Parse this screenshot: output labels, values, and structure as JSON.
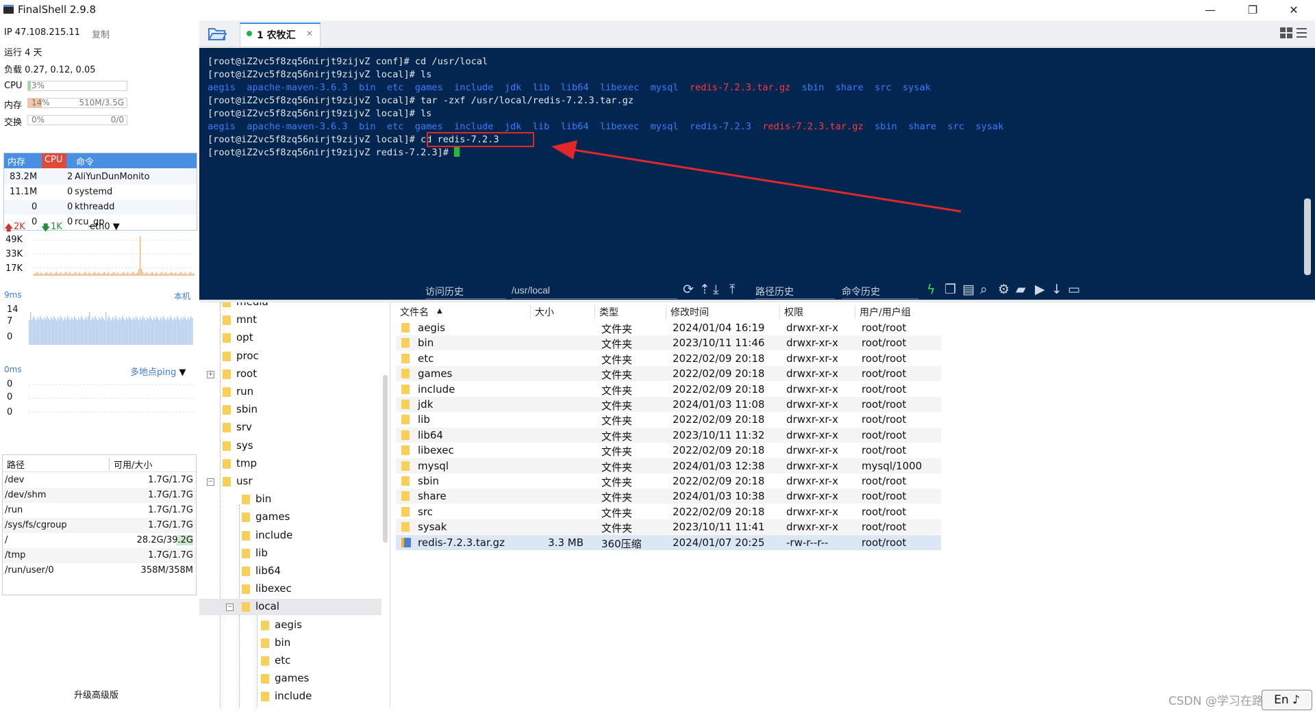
{
  "window": {
    "title": "FinalShell 2.9.8",
    "controls": {
      "minimize": "—",
      "maximize": "❐",
      "close": "✕"
    }
  },
  "sysinfo": {
    "ip_label": "IP 47.108.215.11",
    "copy_label": "复制",
    "uptime": "运行 4 天",
    "load": "负载 0.27, 0.12, 0.05",
    "cpu": {
      "label": "CPU",
      "value": "3%",
      "percent": 3
    },
    "mem": {
      "label": "内存",
      "value": "14%",
      "detail": "510M/3.5G",
      "percent": 14
    },
    "swap": {
      "label": "交换",
      "value": "0%",
      "detail": "0/0",
      "percent": 0
    }
  },
  "process_table": {
    "headers": [
      "内存",
      "CPU",
      "命令"
    ],
    "rows": [
      {
        "mem": "83.2M",
        "cpu": "2",
        "cmd": "AliYunDunMonito"
      },
      {
        "mem": "11.1M",
        "cpu": "0",
        "cmd": "systemd"
      },
      {
        "mem": "0",
        "cpu": "0",
        "cmd": "kthreadd"
      },
      {
        "mem": "0",
        "cpu": "0",
        "cmd": "rcu_gp"
      }
    ]
  },
  "network": {
    "up": "2K",
    "down": "1K",
    "interface": "eth0",
    "y_ticks": [
      "49K",
      "33K",
      "17K"
    ]
  },
  "latency": {
    "value": "9ms",
    "target": "本机",
    "y_ticks": [
      "14",
      "7",
      "0"
    ]
  },
  "ping": {
    "value": "0ms",
    "target": "多地点ping",
    "y_ticks": [
      "0",
      "0",
      "0"
    ]
  },
  "disk_table": {
    "headers": [
      "路径",
      "可用/大小"
    ],
    "rows": [
      {
        "path": "/dev",
        "size": "1.7G/1.7G"
      },
      {
        "path": "/dev/shm",
        "size": "1.7G/1.7G"
      },
      {
        "path": "/run",
        "size": "1.7G/1.7G"
      },
      {
        "path": "/sys/fs/cgroup",
        "size": "1.7G/1.7G"
      },
      {
        "path": "/",
        "size": "28.2G/39.2G"
      },
      {
        "path": "/tmp",
        "size": "1.7G/1.7G"
      },
      {
        "path": "/run/user/0",
        "size": "358M/358M"
      }
    ]
  },
  "upgrade_label": "升级高级版",
  "tab": {
    "label": "1 农牧汇",
    "close": "✕"
  },
  "terminal": {
    "lines": [
      {
        "prompt": "[root@iZ2vc5f8zq56nirjt9zijvZ conf]# ",
        "cmd": "cd /usr/local"
      },
      {
        "prompt": "[root@iZ2vc5f8zq56nirjt9zijvZ local]# ",
        "cmd": "ls"
      },
      {
        "prompt": "[root@iZ2vc5f8zq56nirjt9zijvZ local]# ",
        "cmd": "tar -zxf /usr/local/redis-7.2.3.tar.gz"
      },
      {
        "prompt": "[root@iZ2vc5f8zq56nirjt9zijvZ local]# ",
        "cmd": "ls"
      },
      {
        "prompt": "[root@iZ2vc5f8zq56nirjt9zijvZ local]# ",
        "cmd": "cd redis-7.2.3"
      },
      {
        "prompt": "[root@iZ2vc5f8zq56nirjt9zijvZ redis-7.2.3]# ",
        "cmd": ""
      }
    ],
    "ls1": [
      "aegis",
      "apache-maven-3.6.3",
      "bin",
      "etc",
      "games",
      "include",
      "jdk",
      "lib",
      "lib64",
      "libexec",
      "mysql",
      "redis-7.2.3.tar.gz",
      "sbin",
      "share",
      "src",
      "sysak"
    ],
    "ls2": [
      "aegis",
      "apache-maven-3.6.3",
      "bin",
      "etc",
      "games",
      "include",
      "jdk",
      "lib",
      "lib64",
      "libexec",
      "mysql",
      "redis-7.2.3",
      "redis-7.2.3.tar.gz",
      "sbin",
      "share",
      "src",
      "sysak"
    ],
    "archive_name": "redis-7.2.3.tar.gz",
    "colors": {
      "background": "#032650",
      "dir": "#3a7cff",
      "archive": "#ff3b3b",
      "cursor": "#19c13b",
      "highlight": "#e02828"
    }
  },
  "term_toolbar": {
    "history_label": "访问历史",
    "path_value": "/usr/local",
    "path_history_label": "路径历史",
    "cmd_history_label": "命令历史"
  },
  "tree": {
    "items": [
      {
        "label": "media",
        "depth": 0
      },
      {
        "label": "mnt",
        "depth": 0
      },
      {
        "label": "opt",
        "depth": 0
      },
      {
        "label": "proc",
        "depth": 0
      },
      {
        "label": "root",
        "depth": 0,
        "expander": "⊞"
      },
      {
        "label": "run",
        "depth": 0
      },
      {
        "label": "sbin",
        "depth": 0
      },
      {
        "label": "srv",
        "depth": 0
      },
      {
        "label": "sys",
        "depth": 0
      },
      {
        "label": "tmp",
        "depth": 0
      },
      {
        "label": "usr",
        "depth": 0,
        "expander": "⊟"
      },
      {
        "label": "bin",
        "depth": 1
      },
      {
        "label": "games",
        "depth": 1
      },
      {
        "label": "include",
        "depth": 1
      },
      {
        "label": "lib",
        "depth": 1
      },
      {
        "label": "lib64",
        "depth": 1
      },
      {
        "label": "libexec",
        "depth": 1
      },
      {
        "label": "local",
        "depth": 1,
        "expander": "⊟",
        "selected": true
      },
      {
        "label": "aegis",
        "depth": 2
      },
      {
        "label": "bin",
        "depth": 2
      },
      {
        "label": "etc",
        "depth": 2
      },
      {
        "label": "games",
        "depth": 2
      },
      {
        "label": "include",
        "depth": 2
      }
    ]
  },
  "files": {
    "headers": [
      "文件名",
      "大小",
      "类型",
      "修改时间",
      "权限",
      "用户/用户组"
    ],
    "rows": [
      {
        "name": "aegis",
        "size": "",
        "type": "文件夹",
        "mtime": "2024/01/04 16:19",
        "perm": "drwxr-xr-x",
        "owner": "root/root"
      },
      {
        "name": "bin",
        "size": "",
        "type": "文件夹",
        "mtime": "2023/10/11 11:46",
        "perm": "drwxr-xr-x",
        "owner": "root/root"
      },
      {
        "name": "etc",
        "size": "",
        "type": "文件夹",
        "mtime": "2022/02/09 20:18",
        "perm": "drwxr-xr-x",
        "owner": "root/root"
      },
      {
        "name": "games",
        "size": "",
        "type": "文件夹",
        "mtime": "2022/02/09 20:18",
        "perm": "drwxr-xr-x",
        "owner": "root/root"
      },
      {
        "name": "include",
        "size": "",
        "type": "文件夹",
        "mtime": "2022/02/09 20:18",
        "perm": "drwxr-xr-x",
        "owner": "root/root"
      },
      {
        "name": "jdk",
        "size": "",
        "type": "文件夹",
        "mtime": "2024/01/03 11:08",
        "perm": "drwxr-xr-x",
        "owner": "root/root"
      },
      {
        "name": "lib",
        "size": "",
        "type": "文件夹",
        "mtime": "2022/02/09 20:18",
        "perm": "drwxr-xr-x",
        "owner": "root/root"
      },
      {
        "name": "lib64",
        "size": "",
        "type": "文件夹",
        "mtime": "2023/10/11 11:32",
        "perm": "drwxr-xr-x",
        "owner": "root/root"
      },
      {
        "name": "libexec",
        "size": "",
        "type": "文件夹",
        "mtime": "2022/02/09 20:18",
        "perm": "drwxr-xr-x",
        "owner": "root/root"
      },
      {
        "name": "mysql",
        "size": "",
        "type": "文件夹",
        "mtime": "2024/01/03 12:38",
        "perm": "drwxr-xr-x",
        "owner": "mysql/1000"
      },
      {
        "name": "sbin",
        "size": "",
        "type": "文件夹",
        "mtime": "2022/02/09 20:18",
        "perm": "drwxr-xr-x",
        "owner": "root/root"
      },
      {
        "name": "share",
        "size": "",
        "type": "文件夹",
        "mtime": "2024/01/03 10:38",
        "perm": "drwxr-xr-x",
        "owner": "root/root"
      },
      {
        "name": "src",
        "size": "",
        "type": "文件夹",
        "mtime": "2022/02/09 20:18",
        "perm": "drwxr-xr-x",
        "owner": "root/root"
      },
      {
        "name": "sysak",
        "size": "",
        "type": "文件夹",
        "mtime": "2023/10/11 11:41",
        "perm": "drwxr-xr-x",
        "owner": "root/root"
      },
      {
        "name": "redis-7.2.3.tar.gz",
        "size": "3.3 MB",
        "type": "360压缩",
        "mtime": "2024/01/07 20:25",
        "perm": "-rw-r--r--",
        "owner": "root/root",
        "selected": true
      }
    ]
  },
  "watermark": "CSDN @学习在路上ing",
  "ime": "En ♪"
}
